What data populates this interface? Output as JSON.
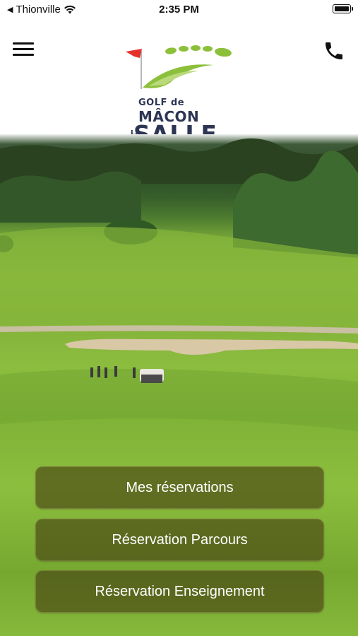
{
  "status_bar": {
    "carrier": "Thionville",
    "time": "2:35 PM"
  },
  "header": {
    "logo": {
      "line1": "GOLF de",
      "line2": "MÂCON",
      "line3_small": "La",
      "line3": "SALLE"
    },
    "menu_icon": "hamburger-icon",
    "phone_icon": "phone-icon"
  },
  "hero": {
    "image": "golf-course-aerial-photo"
  },
  "actions": [
    {
      "label": "Mes réservations"
    },
    {
      "label": "Réservation Parcours"
    },
    {
      "label": "Réservation Enseignement"
    }
  ],
  "colors": {
    "logo_text": "#2d3554",
    "logo_green": "#8cc03a",
    "logo_flag": "#e5322d",
    "button_bg": "rgba(70,62,18,0.62)"
  }
}
